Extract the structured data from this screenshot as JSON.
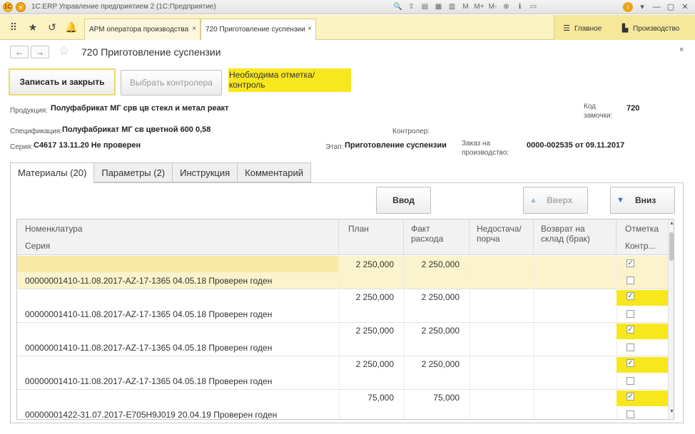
{
  "window": {
    "title": "1С:ERP Управление предприятием 2  (1С:Предприятие)",
    "toolbar_marks": [
      "M",
      "M+",
      "M-"
    ]
  },
  "sections": {
    "open_tabs": [
      {
        "label": "АРМ оператора производства",
        "close": "×"
      },
      {
        "label": "720 Приготовление суспензии",
        "close": "×"
      }
    ],
    "nav": [
      {
        "label": "Главное",
        "icon": "menu-icon"
      },
      {
        "label": "Производство",
        "icon": "factory-icon"
      }
    ]
  },
  "form": {
    "title": "720 Приготовление суспензии",
    "back": "←",
    "forward": "→",
    "close": "×",
    "buttons": {
      "save_close": "Записать и закрыть",
      "choose_controller": "Выбрать контролера"
    },
    "notice": "Необходима отметка/ контроль"
  },
  "fields": {
    "product_label": "Продукция:",
    "product_value": "Полуфабрикат МГ срв цв стекл и метал реакт",
    "spec_label": "Спецификация:",
    "spec_value": "Полуфабрикат МГ св цветной 600 0,58",
    "series_label": "Серия:",
    "series_value": "С4617 13.11.20 Не проверен",
    "stage_label": "Этап:",
    "stage_value": "Приготовление суспензии",
    "order_label_1": "Заказ на",
    "order_label_2": "производство:",
    "order_value": "0000-002535 от 09.11.2017",
    "controller_label": "Контролер:",
    "code_label_1": "Код",
    "code_label_2": "замочки:",
    "code_value": "720"
  },
  "tabs": [
    "Материалы (20)",
    "Параметры (2)",
    "Инструкция",
    "Комментарий"
  ],
  "table_commands": {
    "input": "Ввод",
    "up": "Вверх",
    "down": "Вниз"
  },
  "grid": {
    "headers": {
      "nomenclature": "Номенклатура",
      "series": "Серия",
      "plan": "План",
      "fact_1": "Факт",
      "fact_2": "расхода",
      "shortage_1": "Недостача/",
      "shortage_2": "порча",
      "return_1": "Возврат на",
      "return_2": "склад (брак)",
      "mark": "Отметка",
      "control": "Контр..."
    },
    "rows": [
      {
        "nomenclature": "",
        "series": "00000001410-11.08.2017-AZ-17-1365 04.05.18 Проверен годен",
        "plan": "2 250,000",
        "fact": "2 250,000",
        "mark": true,
        "control": false
      },
      {
        "nomenclature": "",
        "series": "00000001410-11.08.2017-AZ-17-1365 04.05.18 Проверен годен",
        "plan": "2 250,000",
        "fact": "2 250,000",
        "mark": true,
        "control": false
      },
      {
        "nomenclature": "",
        "series": "00000001410-11.08.2017-AZ-17-1365 04.05.18 Проверен годен",
        "plan": "2 250,000",
        "fact": "2 250,000",
        "mark": true,
        "control": false
      },
      {
        "nomenclature": "",
        "series": "00000001410-11.08.2017-AZ-17-1365 04.05.18 Проверен годен",
        "plan": "2 250,000",
        "fact": "2 250,000",
        "mark": true,
        "control": false
      },
      {
        "nomenclature": "",
        "series": "00000001422-31.07.2017-E705H9J019 20.04.19 Проверен годен",
        "plan": "75,000",
        "fact": "75,000",
        "mark": true,
        "control": false
      }
    ]
  },
  "colors": {
    "section_bar": "#fbf3c2",
    "highlight": "#f8e71c",
    "selected_row": "#fbf3cc",
    "check_green": "#1c8c2c"
  }
}
